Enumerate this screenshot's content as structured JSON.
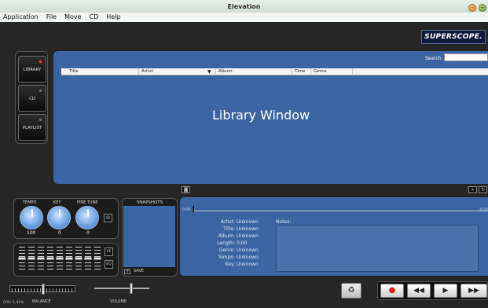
{
  "window": {
    "title": "Elevation",
    "min_symbol": "–",
    "max_symbol": "+"
  },
  "menu": [
    "Application",
    "File",
    "Move",
    "CD",
    "Help"
  ],
  "brand": "SUPERSCOPE.",
  "nav": {
    "library": "LIBRARY",
    "cd": "CD",
    "playlist": "PLAYLIST"
  },
  "library": {
    "search_label": "Search",
    "search_value": "",
    "columns": [
      "Title",
      "Artist",
      "Album",
      "Time",
      "Genre"
    ],
    "placeholder": "Library Window"
  },
  "controls": {
    "tempo_label": "TEMPO",
    "key_label": "KEY",
    "finetune_label": "FINE TUNE",
    "tempo_value": "100",
    "key_value": "0",
    "finetune_value": "0",
    "eq_btn_ve": "VE",
    "eq_btn_eq": "EQ"
  },
  "snapshots": {
    "title": "SNAPSHOTS",
    "add": "+",
    "save": "SAVE"
  },
  "info": {
    "time_start": "0:00",
    "time_end": "-0:00",
    "rows": [
      {
        "key": "Artist:",
        "value": "Unknown"
      },
      {
        "key": "Title:",
        "value": "Unknown"
      },
      {
        "key": "Album:",
        "value": "Unknown"
      },
      {
        "key": "Length:",
        "value": "0:00"
      },
      {
        "key": "Genre:",
        "value": "Unknown"
      },
      {
        "key": "Tempo:",
        "value": "Unknown"
      },
      {
        "key": "Key:",
        "value": "Unknown"
      }
    ],
    "notes_label": "Notes:"
  },
  "bottom": {
    "cpu": "CPU: 1.41%",
    "balance_label": "BALANCE",
    "volume_label": "VOLUME",
    "transport": {
      "record": "●",
      "rewind": "◀◀",
      "play": "▶",
      "ffwd": "▶▶"
    }
  },
  "colors": {
    "panel_blue": "#3c66a3",
    "record_red": "#e5211a"
  }
}
